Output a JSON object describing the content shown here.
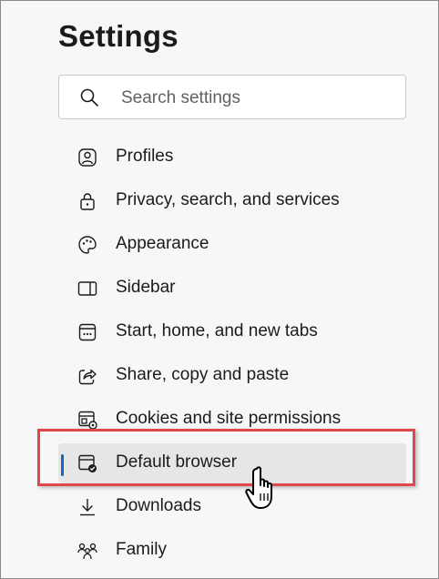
{
  "header": {
    "title": "Settings"
  },
  "search": {
    "placeholder": "Search settings",
    "icon": "search-icon"
  },
  "nav": {
    "items": [
      {
        "label": "Profiles",
        "icon": "profile-icon"
      },
      {
        "label": "Privacy, search, and services",
        "icon": "lock-icon"
      },
      {
        "label": "Appearance",
        "icon": "palette-icon"
      },
      {
        "label": "Sidebar",
        "icon": "sidebar-icon"
      },
      {
        "label": "Start, home, and new tabs",
        "icon": "new-tab-icon"
      },
      {
        "label": "Share, copy and paste",
        "icon": "share-icon"
      },
      {
        "label": "Cookies and site permissions",
        "icon": "cookies-icon"
      },
      {
        "label": "Default browser",
        "icon": "default-browser-icon",
        "active": true
      },
      {
        "label": "Downloads",
        "icon": "download-icon"
      },
      {
        "label": "Family",
        "icon": "family-icon"
      }
    ]
  },
  "colors": {
    "active_indicator": "#0f6cbd",
    "highlight_border": "#e0474c"
  },
  "cursor": {
    "icon": "hand-pointer-icon"
  }
}
